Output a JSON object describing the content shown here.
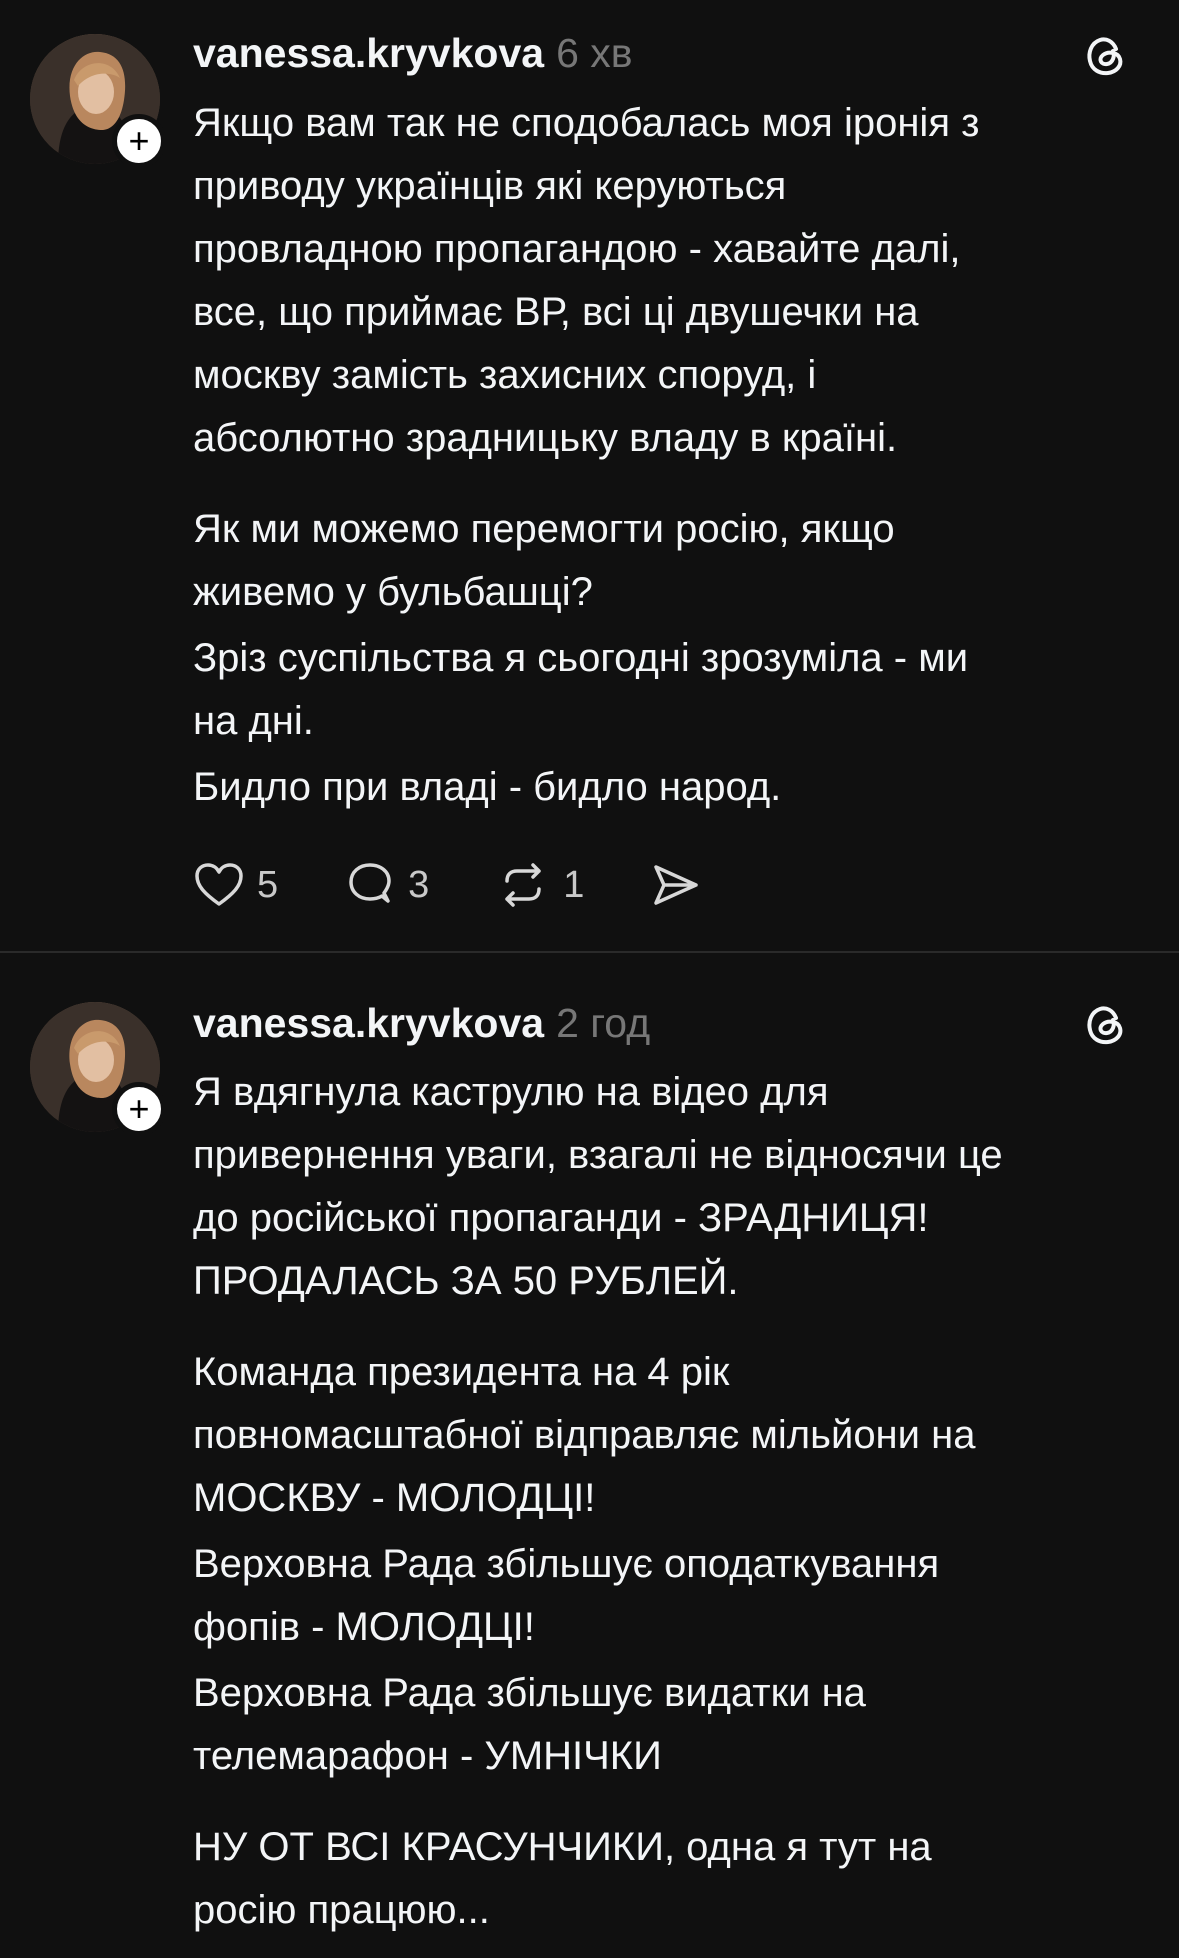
{
  "posts": [
    {
      "username": "vanessa.kryvkova",
      "time": "6 хв",
      "paragraphs": [
        "Якщо вам так не сподобалась моя іронія з\nприводу українців які керуються\nпровладною пропагандою - хавайте далі,\nвсе, що приймає ВР, всі ці двушечки на\nмоскву замість захисних споруд, і\nабсолютно зрадницьку владу в країні.",
        "Як ми можемо перемогти росію, якщо\nживемо у бульбашці?",
        "Зріз суспільства я сьогодні зрозуміла - ми\nна дні.",
        "Бидло при владі - бидло народ."
      ],
      "actions": {
        "likes": "5",
        "replies": "3",
        "reposts": "1"
      }
    },
    {
      "username": "vanessa.kryvkova",
      "time": "2 год",
      "paragraphs": [
        "Я вдягнула каструлю на відео для\nпривернення уваги, взагалі не відносячи це\nдо російської пропаганди - ЗРАДНИЦЯ!\nПРОДАЛАСЬ ЗА 50 РУБЛЕЙ.",
        "Команда президента на 4 рік\nповномасштабної відправляє мільйони на\nМОСКВУ - МОЛОДЦІ!",
        "Верховна Рада збільшує оподаткування\nфопів - МОЛОДЦІ!",
        "Верховна Рада збільшує видатки на\nтелемарафон - УМНІЧКИ",
        "НУ ОТ ВСІ КРАСУНЧИКИ, одна я тут на\nросію працюю..."
      ]
    }
  ],
  "icons": {
    "avatar": "avatar-photo",
    "follow": "plus-icon",
    "brand": "threads-logo-icon",
    "like": "heart-icon",
    "reply": "comment-bubble-icon",
    "repost": "repost-arrows-icon",
    "share": "send-icon"
  },
  "colors": {
    "background": "#101010",
    "text": "#f3f5f7",
    "muted": "#777777",
    "divider": "#2a2a2a"
  },
  "follow_symbol": "+"
}
